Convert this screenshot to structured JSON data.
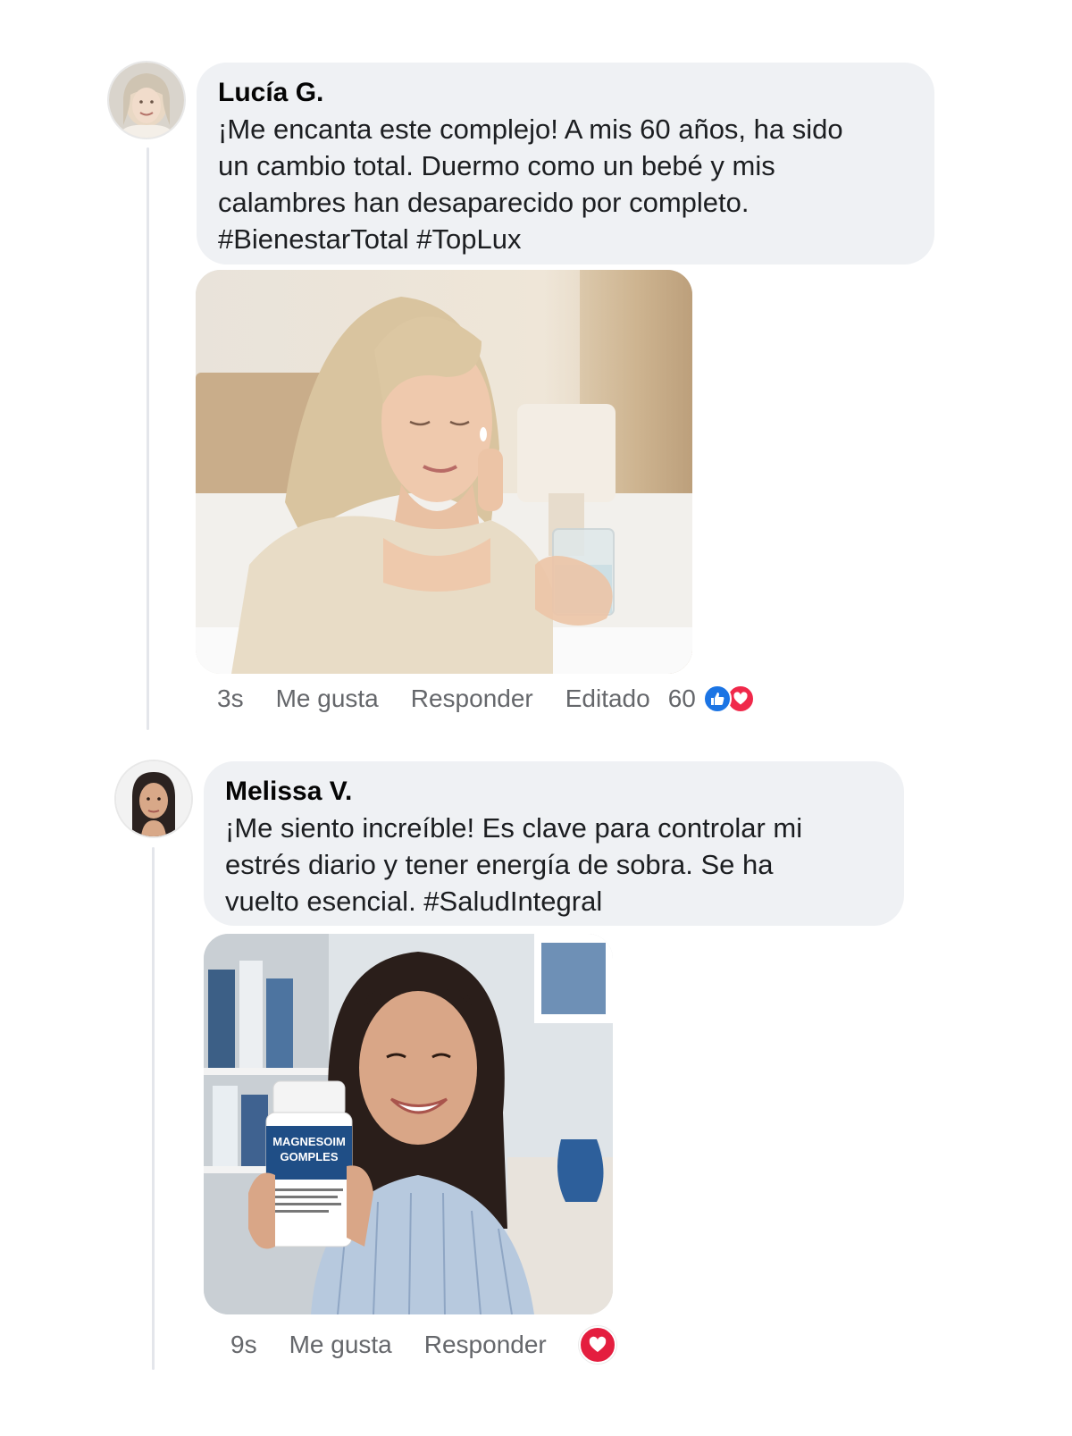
{
  "comments": [
    {
      "author": "Lucía G.",
      "text": "¡Me encanta este complejo! A mis 60 años, ha sido\nun cambio total. Duermo como un bebé y mis\ncalambres han desaparecido por completo.\n#BienestarTotal #TopLux",
      "time": "3s",
      "like_label": "Me gusta",
      "reply_label": "Responder",
      "edited_label": "Editado",
      "reaction_count": "60",
      "reactions": [
        "like-icon",
        "love-icon"
      ],
      "photo": "woman-taking-pill-photo"
    },
    {
      "author": "Melissa V.",
      "text": "¡Me siento increíble! Es clave para controlar mi\nestrés diario y tener energía de sobra. Se ha\nvuelto esencial. #SaludIntegral",
      "time": "9s",
      "like_label": "Me gusta",
      "reply_label": "Responder",
      "reactions": [
        "love-icon"
      ],
      "photo": "woman-holding-supplement-photo",
      "bottle_label_line1": "MAGNESOIM",
      "bottle_label_line2": "GOMPLES"
    }
  ],
  "colors": {
    "bubble": "#eff1f4",
    "meta_text": "#65676b",
    "like_blue": "#1b74e4",
    "love_red": "#f0284a"
  }
}
